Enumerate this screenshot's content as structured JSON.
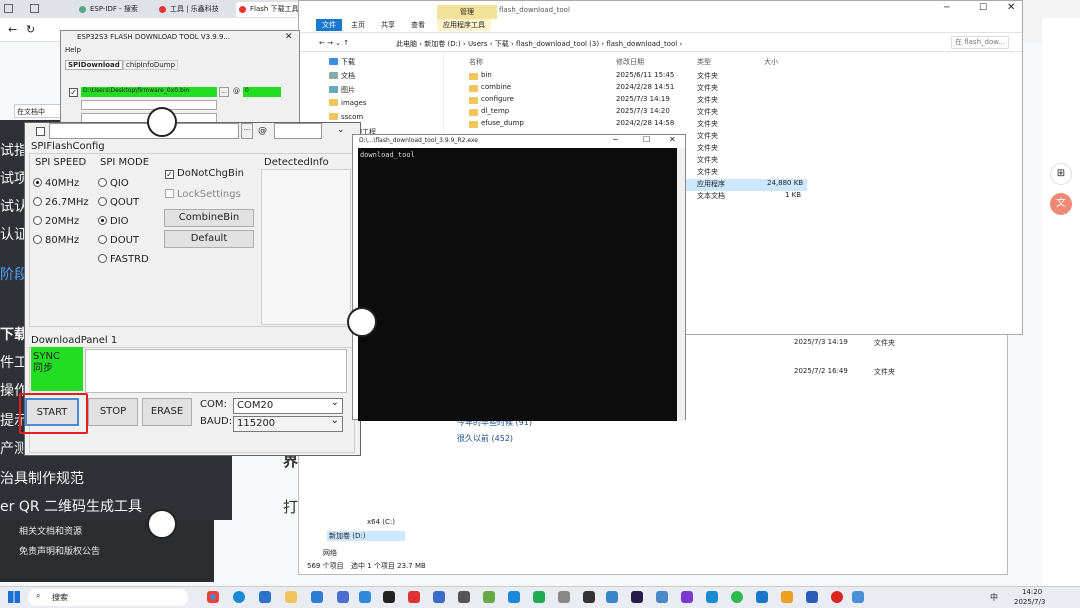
{
  "browser": {
    "tabs": [
      "ESP-IDF - 搜索",
      "工具 | 乐鑫科技",
      "Flash 下载工具"
    ],
    "page_placeholder": "在文档中"
  },
  "web": {
    "dark_lines": [
      "试指",
      "试项",
      "试认",
      "认证",
      "阶段"
    ],
    "lower_lines": [
      "下载",
      "件工作",
      "操作",
      "提示",
      "产测流程",
      "治具制作规范",
      "er QR 二维码生成工具"
    ],
    "footer": [
      "相关文档和资源",
      "免责声明和版权公告"
    ],
    "heading": "界面入口",
    "open_text": "打开 Flash"
  },
  "explorer": {
    "ribbon_tabs": [
      "文件",
      "主页",
      "共享",
      "查看",
      "应用程序工具"
    ],
    "manage_tab": "管理",
    "window_title": "flash_download_tool",
    "path": [
      "此电脑",
      "新加卷 (D:)",
      "Users",
      "下载",
      "flash_download_tool (3)",
      "flash_download_tool"
    ],
    "search_placeholder": "在 flash_dow...",
    "nav": [
      "下载",
      "文档",
      "图片",
      "images",
      "sscom",
      "给我的工程"
    ],
    "columns": [
      "名称",
      "修改日期",
      "类型",
      "大小"
    ],
    "files": [
      {
        "name": "bin",
        "date": "2025/6/11 15:45",
        "type": "文件夹",
        "size": ""
      },
      {
        "name": "combine",
        "date": "2024/2/28 14:51",
        "type": "文件夹",
        "size": ""
      },
      {
        "name": "configure",
        "date": "2025/7/3 14:19",
        "type": "文件夹",
        "size": ""
      },
      {
        "name": "dl_temp",
        "date": "2025/7/3 14:20",
        "type": "文件夹",
        "size": ""
      },
      {
        "name": "efuse_dump",
        "date": "2024/2/28 14:58",
        "type": "文件夹",
        "size": ""
      }
    ],
    "extra_types": [
      "文件夹",
      "文件夹",
      "文件夹",
      "文件夹",
      "应用程序",
      "文本文档"
    ],
    "extra_sizes": [
      "24,880 KB",
      "1 KB"
    ],
    "lower_rows": [
      {
        "date": "2025/7/3 14:19",
        "type": "文件夹"
      },
      {
        "date": "2025/7/2 16:49",
        "type": "文件夹"
      }
    ],
    "groups": [
      "今年的早些时候 (91)",
      "很久以前 (452)"
    ],
    "drives": [
      "x64 (C:)",
      "新加卷 (D:)",
      "网络"
    ],
    "status": [
      "569 个项目",
      "选中 1 个项目  23.7 MB"
    ]
  },
  "flash": {
    "title": "ESP32S3 FLASH DOWNLOAD TOOL V3.9.9...",
    "menu": "Help",
    "tabs": [
      "SPIDownload",
      "chipInfoDump"
    ],
    "file_path": "D:\\Users\\Desktop\\firmware_0x0.bin",
    "at": "@",
    "addr": "0"
  },
  "spi": {
    "group_title": "SPIFlashConfig",
    "speed_title": "SPI SPEED",
    "mode_title": "SPI MODE",
    "speeds": [
      "40MHz",
      "26.7MHz",
      "20MHz",
      "80MHz"
    ],
    "speed_selected": "40MHz",
    "modes": [
      "QIO",
      "QOUT",
      "DIO",
      "DOUT",
      "FASTRD"
    ],
    "mode_selected": "DIO",
    "donotchg": "DoNotChgBin",
    "lock": "LockSettings",
    "combine": "CombineBin",
    "default": "Default",
    "detected": "DetectedInfo",
    "panel": "DownloadPanel 1",
    "sync": "SYNC\n同步",
    "start": "START",
    "stop": "STOP",
    "erase": "ERASE",
    "com_label": "COM:",
    "com": "COM20",
    "baud_label": "BAUD:",
    "baud": "115200"
  },
  "console": {
    "title": "D:\\...\\flash_download_tool_3.9.9_R2.exe",
    "line": "download_tool"
  },
  "taskbar": {
    "search": "搜索",
    "time": "14:20",
    "date": "2025/7/3",
    "lang": "中"
  },
  "colors": {
    "sync_green": "#22dd22",
    "highlight_red": "#e02020",
    "explorer_blue": "#1979ca"
  }
}
